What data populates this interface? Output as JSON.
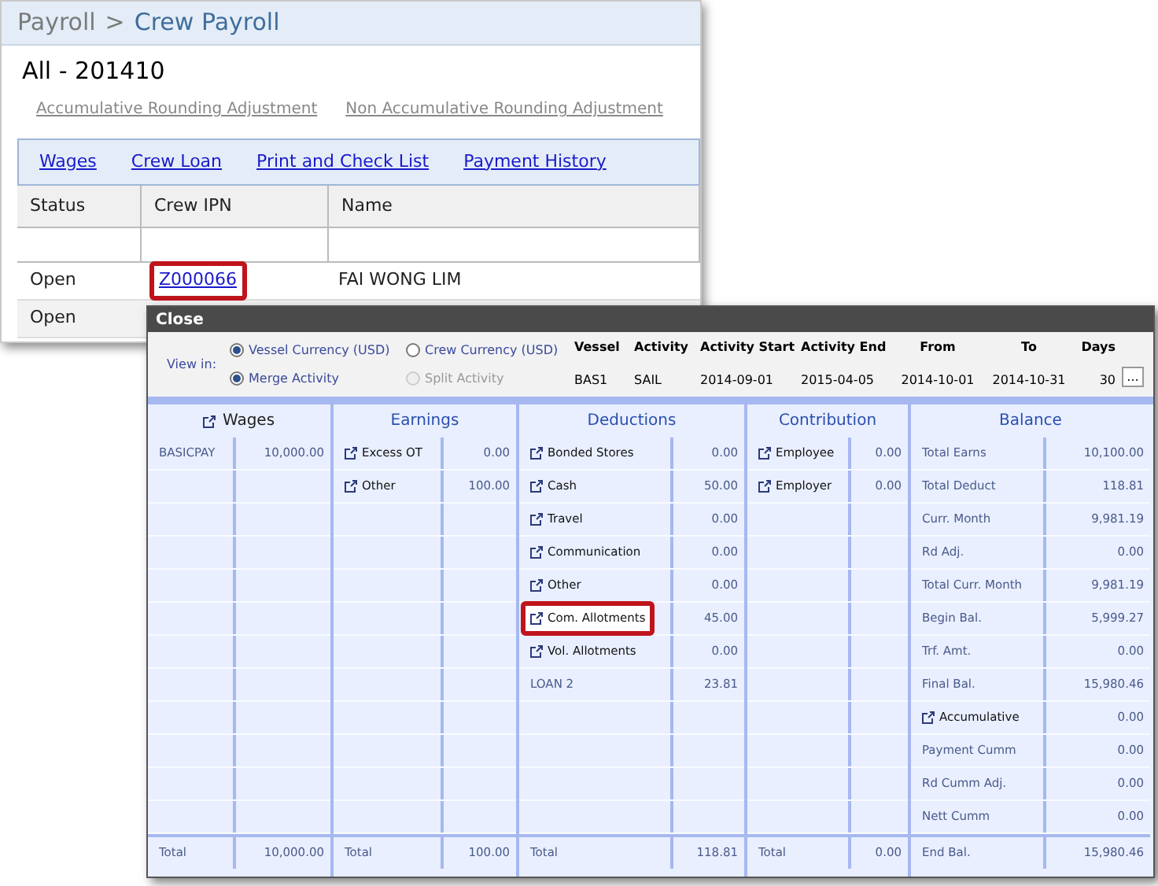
{
  "main_window": {
    "breadcrumb": {
      "parent": "Payroll",
      "separator": ">",
      "current": "Crew Payroll"
    },
    "heading": "All - 201410",
    "adjust_links": [
      "Accumulative Rounding Adjustment",
      "Non Accumulative Rounding Adjustment"
    ],
    "tabs": [
      "Wages",
      "Crew Loan",
      "Print and Check List",
      "Payment History"
    ],
    "table": {
      "columns": [
        "Status",
        "Crew IPN",
        "Name"
      ],
      "rows": [
        {
          "status": "Open",
          "crew_ipn": "Z000066",
          "name": "FAI WONG LIM",
          "highlighted": true
        },
        {
          "status": "Open",
          "highlighted": false
        }
      ]
    }
  },
  "dialog": {
    "title": "Close",
    "view_in_label": "View in:",
    "options": [
      {
        "label": "Vessel Currency (USD)",
        "checked": true,
        "disabled": false
      },
      {
        "label": "Crew Currency (USD)",
        "checked": false,
        "disabled": false
      },
      {
        "label": "Merge Activity",
        "checked": true,
        "disabled": false
      },
      {
        "label": "Split Activity",
        "checked": false,
        "disabled": true
      }
    ],
    "info": [
      {
        "label": "Vessel",
        "value": "BAS1"
      },
      {
        "label": "Activity",
        "value": "SAIL"
      },
      {
        "label": "Activity Start",
        "value": "2014-09-01"
      },
      {
        "label": "Activity End",
        "value": "2015-04-05"
      },
      {
        "label": "From",
        "value": "2014-10-01"
      },
      {
        "label": "To",
        "value": "2014-10-31"
      },
      {
        "label": "Days",
        "value": "30"
      }
    ],
    "more_button": "...",
    "sections": [
      {
        "heading": "Wages",
        "icon": true,
        "rows": [
          {
            "label": "BASICPAY",
            "value": "10,000.00",
            "icon": false,
            "highlighted": false
          }
        ],
        "total": {
          "label": "Total",
          "value": "10,000.00"
        }
      },
      {
        "heading": "Earnings",
        "icon": false,
        "rows": [
          {
            "label": "Excess OT",
            "value": "0.00",
            "icon": true,
            "highlighted": false
          },
          {
            "label": "Other",
            "value": "100.00",
            "icon": true,
            "highlighted": false
          }
        ],
        "total": {
          "label": "Total",
          "value": "100.00"
        }
      },
      {
        "heading": "Deductions",
        "icon": false,
        "rows": [
          {
            "label": "Bonded Stores",
            "value": "0.00",
            "icon": true,
            "highlighted": false
          },
          {
            "label": "Cash",
            "value": "50.00",
            "icon": true,
            "highlighted": false
          },
          {
            "label": "Travel",
            "value": "0.00",
            "icon": true,
            "highlighted": false
          },
          {
            "label": "Communication",
            "value": "0.00",
            "icon": true,
            "highlighted": false
          },
          {
            "label": "Other",
            "value": "0.00",
            "icon": true,
            "highlighted": false
          },
          {
            "label": "Com. Allotments",
            "value": "45.00",
            "icon": true,
            "highlighted": true
          },
          {
            "label": "Vol. Allotments",
            "value": "0.00",
            "icon": true,
            "highlighted": false
          },
          {
            "label": "LOAN 2",
            "value": "23.81",
            "icon": false,
            "highlighted": false
          }
        ],
        "total": {
          "label": "Total",
          "value": "118.81"
        }
      },
      {
        "heading": "Contribution",
        "icon": false,
        "rows": [
          {
            "label": "Employee",
            "value": "0.00",
            "icon": true,
            "highlighted": false
          },
          {
            "label": "Employer",
            "value": "0.00",
            "icon": true,
            "highlighted": false
          }
        ],
        "total": {
          "label": "Total",
          "value": "0.00"
        }
      },
      {
        "heading": "Balance",
        "icon": false,
        "rows": [
          {
            "label": "Total Earns",
            "value": "10,100.00",
            "icon": false,
            "highlighted": false
          },
          {
            "label": "Total Deduct",
            "value": "118.81",
            "icon": false,
            "highlighted": false
          },
          {
            "label": "Curr. Month",
            "value": "9,981.19",
            "icon": false,
            "highlighted": false
          },
          {
            "label": "Rd Adj.",
            "value": "0.00",
            "icon": false,
            "highlighted": false
          },
          {
            "label": "Total Curr. Month",
            "value": "9,981.19",
            "icon": false,
            "highlighted": false
          },
          {
            "label": "Begin Bal.",
            "value": "5,999.27",
            "icon": false,
            "highlighted": false
          },
          {
            "label": "Trf. Amt.",
            "value": "0.00",
            "icon": false,
            "highlighted": false
          },
          {
            "label": "Final Bal.",
            "value": "15,980.46",
            "icon": false,
            "highlighted": false
          },
          {
            "label": "Accumulative",
            "value": "0.00",
            "icon": true,
            "highlighted": false
          },
          {
            "label": "Payment Cumm",
            "value": "0.00",
            "icon": false,
            "highlighted": false
          },
          {
            "label": "Rd Cumm Adj.",
            "value": "0.00",
            "icon": false,
            "highlighted": false
          },
          {
            "label": "Nett Cumm",
            "value": "0.00",
            "icon": false,
            "highlighted": false
          }
        ],
        "total": {
          "label": "End Bal.",
          "value": "15,980.46"
        }
      }
    ]
  }
}
